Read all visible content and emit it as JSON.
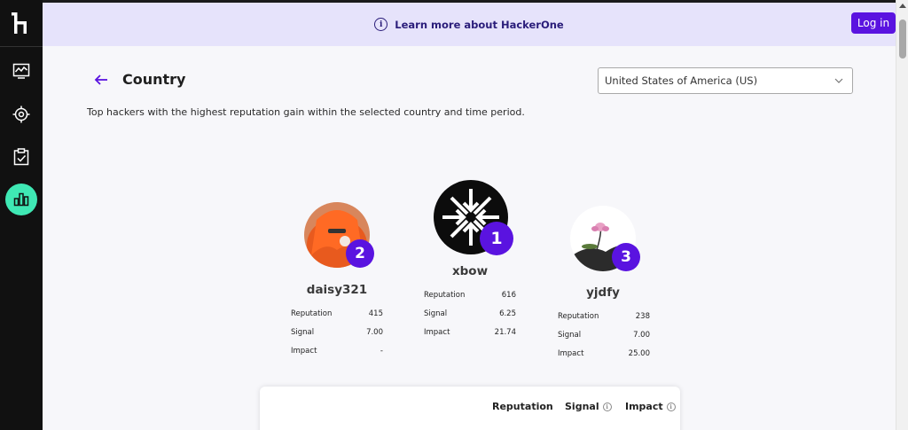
{
  "sidebar": {
    "logo": "hackerone-logo-icon",
    "items": [
      {
        "icon": "dashboard-chart-icon"
      },
      {
        "icon": "target-crosshair-icon"
      },
      {
        "icon": "clipboard-check-icon"
      },
      {
        "icon": "leaderboard-bar-chart-icon",
        "active": true
      }
    ],
    "active_color": "#3fe8b4"
  },
  "banner": {
    "icon": "info-circle-icon",
    "link_text": "Learn more about HackerOne",
    "login_label": "Log in"
  },
  "header": {
    "title": "Country",
    "back_icon": "arrow-left-icon",
    "subtitle": "Top hackers with the highest reputation gain within the selected country and time period."
  },
  "country_select": {
    "selected": "United States of America (US)"
  },
  "leaderboard": {
    "first": {
      "rank": "1",
      "name": "xbow",
      "stats": [
        {
          "label": "Reputation",
          "value": "616"
        },
        {
          "label": "Signal",
          "value": "6.25"
        },
        {
          "label": "Impact",
          "value": "21.74"
        }
      ]
    },
    "second": {
      "rank": "2",
      "name": "daisy321",
      "stats": [
        {
          "label": "Reputation",
          "value": "415"
        },
        {
          "label": "Signal",
          "value": "7.00"
        },
        {
          "label": "Impact",
          "value": "-"
        }
      ]
    },
    "third": {
      "rank": "3",
      "name": "yjdfy",
      "stats": [
        {
          "label": "Reputation",
          "value": "238"
        },
        {
          "label": "Signal",
          "value": "7.00"
        },
        {
          "label": "Impact",
          "value": "25.00"
        }
      ]
    }
  },
  "table": {
    "columns": [
      "Reputation",
      "Signal",
      "Impact"
    ]
  },
  "colors": {
    "accent": "#5a13e0",
    "banner_bg": "#e6e3fb",
    "sidebar_bg": "#111111"
  }
}
